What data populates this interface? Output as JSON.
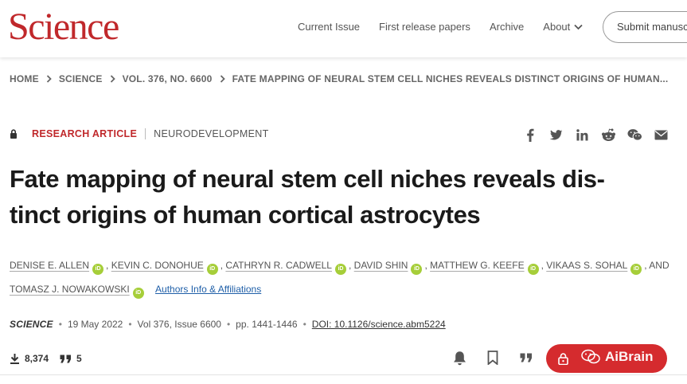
{
  "header": {
    "logo": "Science",
    "nav": [
      "Current Issue",
      "First release papers",
      "Archive",
      "About"
    ],
    "submit_label": "Submit manuscript"
  },
  "breadcrumb": [
    "HOME",
    "SCIENCE",
    "VOL. 376, NO. 6600",
    "FATE MAPPING OF NEURAL STEM CELL NICHES REVEALS DISTINCT ORIGINS OF HUMAN..."
  ],
  "article": {
    "type": "RESEARCH ARTICLE",
    "subject": "NEURODEVELOPMENT",
    "title_line1": "Fate mapping of neural stem cell niches reveals dis-",
    "title_line2": "tinct origins of human cortical astrocytes",
    "authors": [
      "DENISE E. ALLEN",
      "KEVIN C. DONOHUE",
      "CATHRYN R. CADWELL",
      "DAVID SHIN",
      "MATTHEW G. KEEFE",
      "VIKAAS S. SOHAL",
      "TOMASZ J. NOWAKOWSKI"
    ],
    "and_label": ", AND",
    "affiliations_link": "Authors Info & Affiliations",
    "journal": "SCIENCE",
    "date": "19 May 2022",
    "volume": "Vol 376, Issue 6600",
    "pages": "pp. 1441-1446",
    "doi": "DOI: 10.1126/science.abm5224"
  },
  "metrics": {
    "downloads": "8,374",
    "citations": "5"
  },
  "share_icons": [
    "facebook-icon",
    "twitter-icon",
    "linkedin-icon",
    "reddit-icon",
    "wechat-icon",
    "email-icon"
  ],
  "watermark": "AiBrain",
  "colors": {
    "brand": "#c0282b",
    "access_button": "#d52b2e",
    "orcid": "#a6ce39",
    "link": "#1f5fa8"
  }
}
